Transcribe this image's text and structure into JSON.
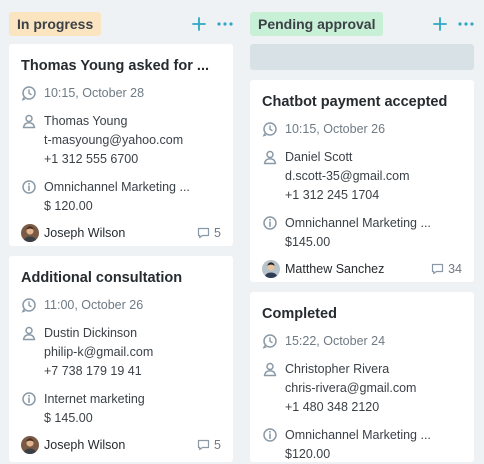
{
  "columns": [
    {
      "stage": "In progress",
      "stage_color": "#fbe5c1",
      "cards": [
        {
          "title": "Thomas Young  asked for ...",
          "time": "10:15, October 28",
          "contact_name": "Thomas Young",
          "contact_email": "t-masyoung@yahoo.com",
          "contact_phone": "+1 312 555 6700",
          "product": "Omnichannel Marketing   ...",
          "price": "$ 120.00",
          "assignee": "Joseph Wilson",
          "comments": "5"
        },
        {
          "title": "Additional consultation",
          "time": "11:00, October 26",
          "contact_name": "Dustin Dickinson",
          "contact_email": "philip-k@gmail.com",
          "contact_phone": "+7 738 179 19 41",
          "product": "Internet marketing",
          "price": "$ 145.00",
          "assignee": "Joseph Wilson",
          "comments": "5"
        }
      ]
    },
    {
      "stage": "Pending approval",
      "stage_color": "#c8f0d6",
      "cards": [
        {
          "title": "Chatbot payment accepted",
          "time": "10:15, October 26",
          "contact_name": "Daniel Scott",
          "contact_email": "d.scott-35@gmail.com",
          "contact_phone": "+1 312 245 1704",
          "product": "Omnichannel Marketing ...",
          "price": "$145.00",
          "assignee": "Matthew Sanchez",
          "comments": "34"
        },
        {
          "title": "Completed",
          "time": "15:22, October 24",
          "contact_name": "Christopher Rivera",
          "contact_email": "chris-rivera@gmail.com",
          "contact_phone": "+1 480 348 2120",
          "product": "Omnichannel Marketing   ...",
          "price": "$120.00"
        }
      ]
    }
  ],
  "icons": {
    "add": "plus-icon",
    "more": "more-horizontal-icon",
    "time": "clock-chat-icon",
    "contact": "person-icon",
    "product": "info-circle-icon",
    "comments": "comment-icon"
  },
  "colors": {
    "accent": "#2fa6c6",
    "icon_gray": "#8a99a6",
    "background": "#eef2f4"
  }
}
